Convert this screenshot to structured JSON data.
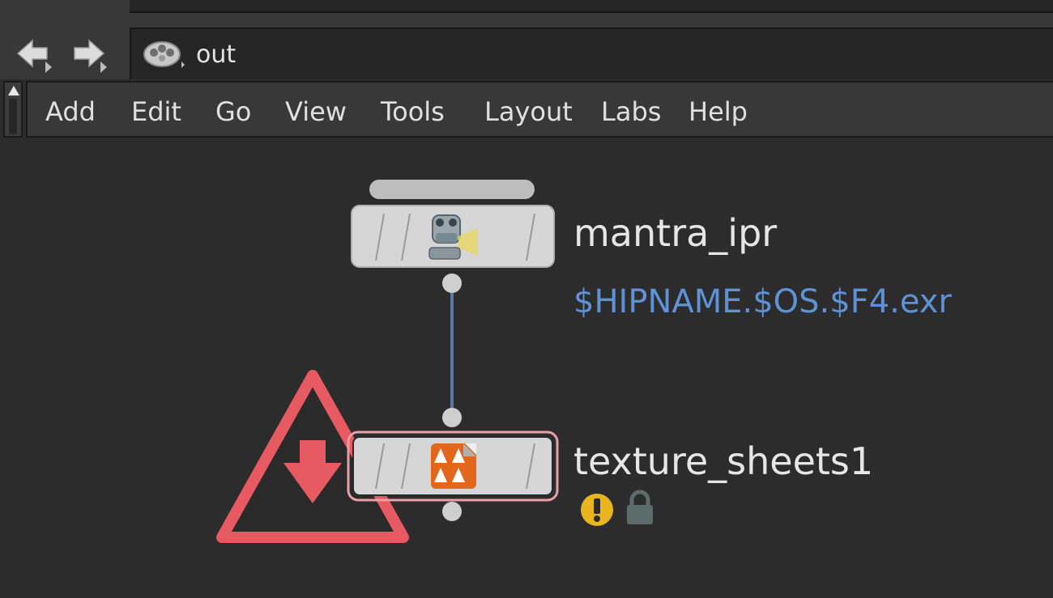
{
  "path_bar": {
    "location": "out",
    "location_icon": "rop-network-icon"
  },
  "nav": {
    "back_icon": "back-arrow-icon",
    "forward_icon": "forward-arrow-icon"
  },
  "menu": {
    "items": [
      "Add",
      "Edit",
      "Go",
      "View",
      "Tools",
      "Layout",
      "Labs",
      "Help"
    ]
  },
  "nodes": [
    {
      "name": "mantra_ipr",
      "output": "$HIPNAME.$OS.$F4.exr",
      "icon": "mantra-camera-icon"
    },
    {
      "name": "texture_sheets1",
      "icon": "texture-sheets-icon",
      "badges": [
        "warning-icon",
        "lock-icon"
      ],
      "flag_icon": "render-flag-triangle-icon"
    }
  ],
  "colors": {
    "accent_blue": "#5e91d6",
    "render_flag": "#e85a62",
    "warning": "#e8b51e",
    "node_body": "#d6d6d6",
    "wire": "#5a78a8"
  }
}
